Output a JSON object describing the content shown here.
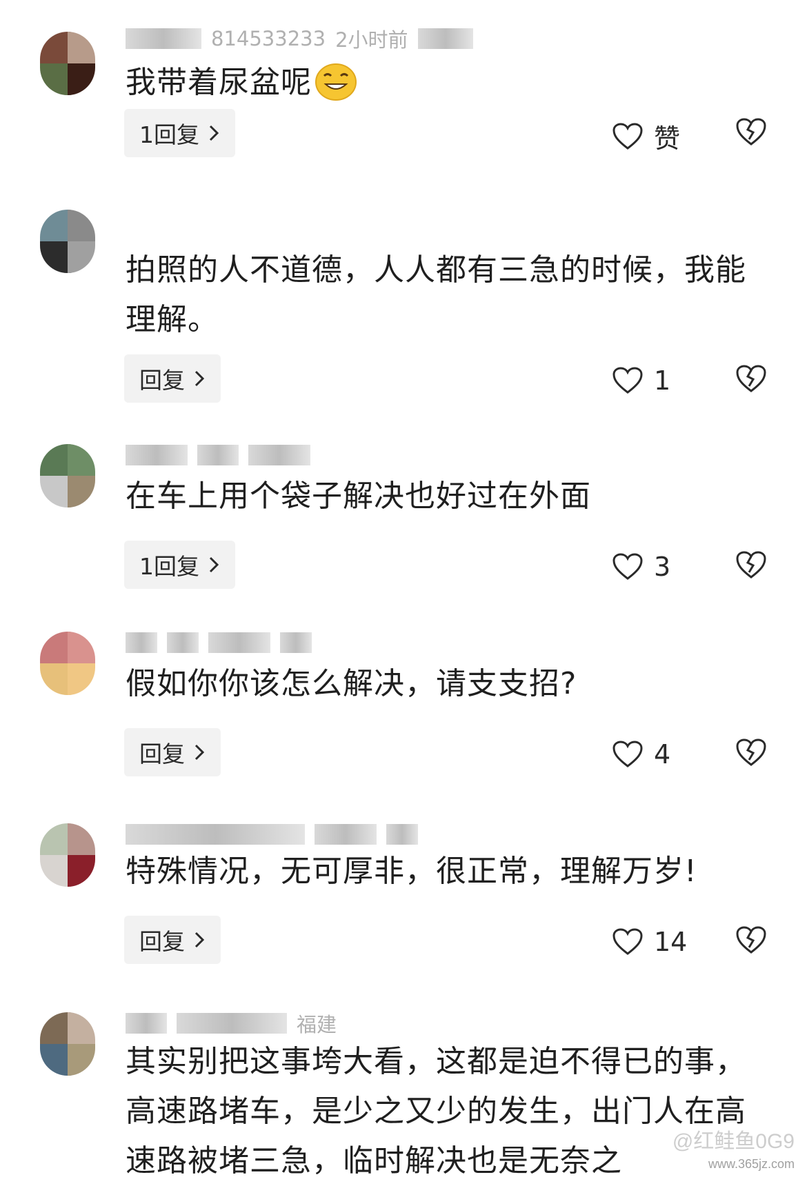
{
  "comments": [
    {
      "meta": "2小时前",
      "meta_partial": "814533233",
      "text": "我带着尿盆呢",
      "has_emoji": true,
      "emoji_icon": "grinning-face-icon",
      "reply_label": "1回复",
      "like_label": "赞",
      "avatar_colors": [
        "#7a4a3a",
        "#b79b8a",
        "#5a6e45",
        "#3a1e16"
      ]
    },
    {
      "meta": "",
      "text": "拍照的人不道德，人人都有三急的时候，我能理解。",
      "reply_label": "回复",
      "like_label": "1",
      "avatar_colors": [
        "#6f8c96",
        "#8a8a8a",
        "#2c2c2c",
        "#a0a0a0"
      ]
    },
    {
      "meta": "",
      "text": "在车上用个袋子解决也好过在外面",
      "reply_label": "1回复",
      "like_label": "3",
      "avatar_colors": [
        "#5a7a55",
        "#6e8e66",
        "#c8c8c8",
        "#9b8a70"
      ]
    },
    {
      "meta": "",
      "text": "假如你你该怎么解决，请支支招?",
      "reply_label": "回复",
      "like_label": "4",
      "avatar_colors": [
        "#c97a7a",
        "#d9928e",
        "#e7c07a",
        "#f0c784"
      ]
    },
    {
      "meta": "",
      "text": "特殊情况，无可厚非，很正常，理解万岁!",
      "reply_label": "回复",
      "like_label": "14",
      "avatar_colors": [
        "#b9c4b0",
        "#b7948c",
        "#d8d4d0",
        "#8a1f2a"
      ]
    },
    {
      "meta": "福建",
      "text": "其实别把这事垮大看，这都是迫不得已的事，高速路堵车，是少之又少的发生，出门人在高速路被堵三急，临时解决也是无奈之",
      "avatar_colors": [
        "#7d6a55",
        "#c4b0a0",
        "#4e6a80",
        "#a89a7a"
      ]
    }
  ],
  "icons": {
    "like": "heart-outline-icon",
    "dislike": "broken-heart-icon",
    "reply_arrow": "chevron-right-icon"
  },
  "watermark": {
    "text": "@红鲑鱼0G9",
    "url": "www.365jz.com"
  }
}
